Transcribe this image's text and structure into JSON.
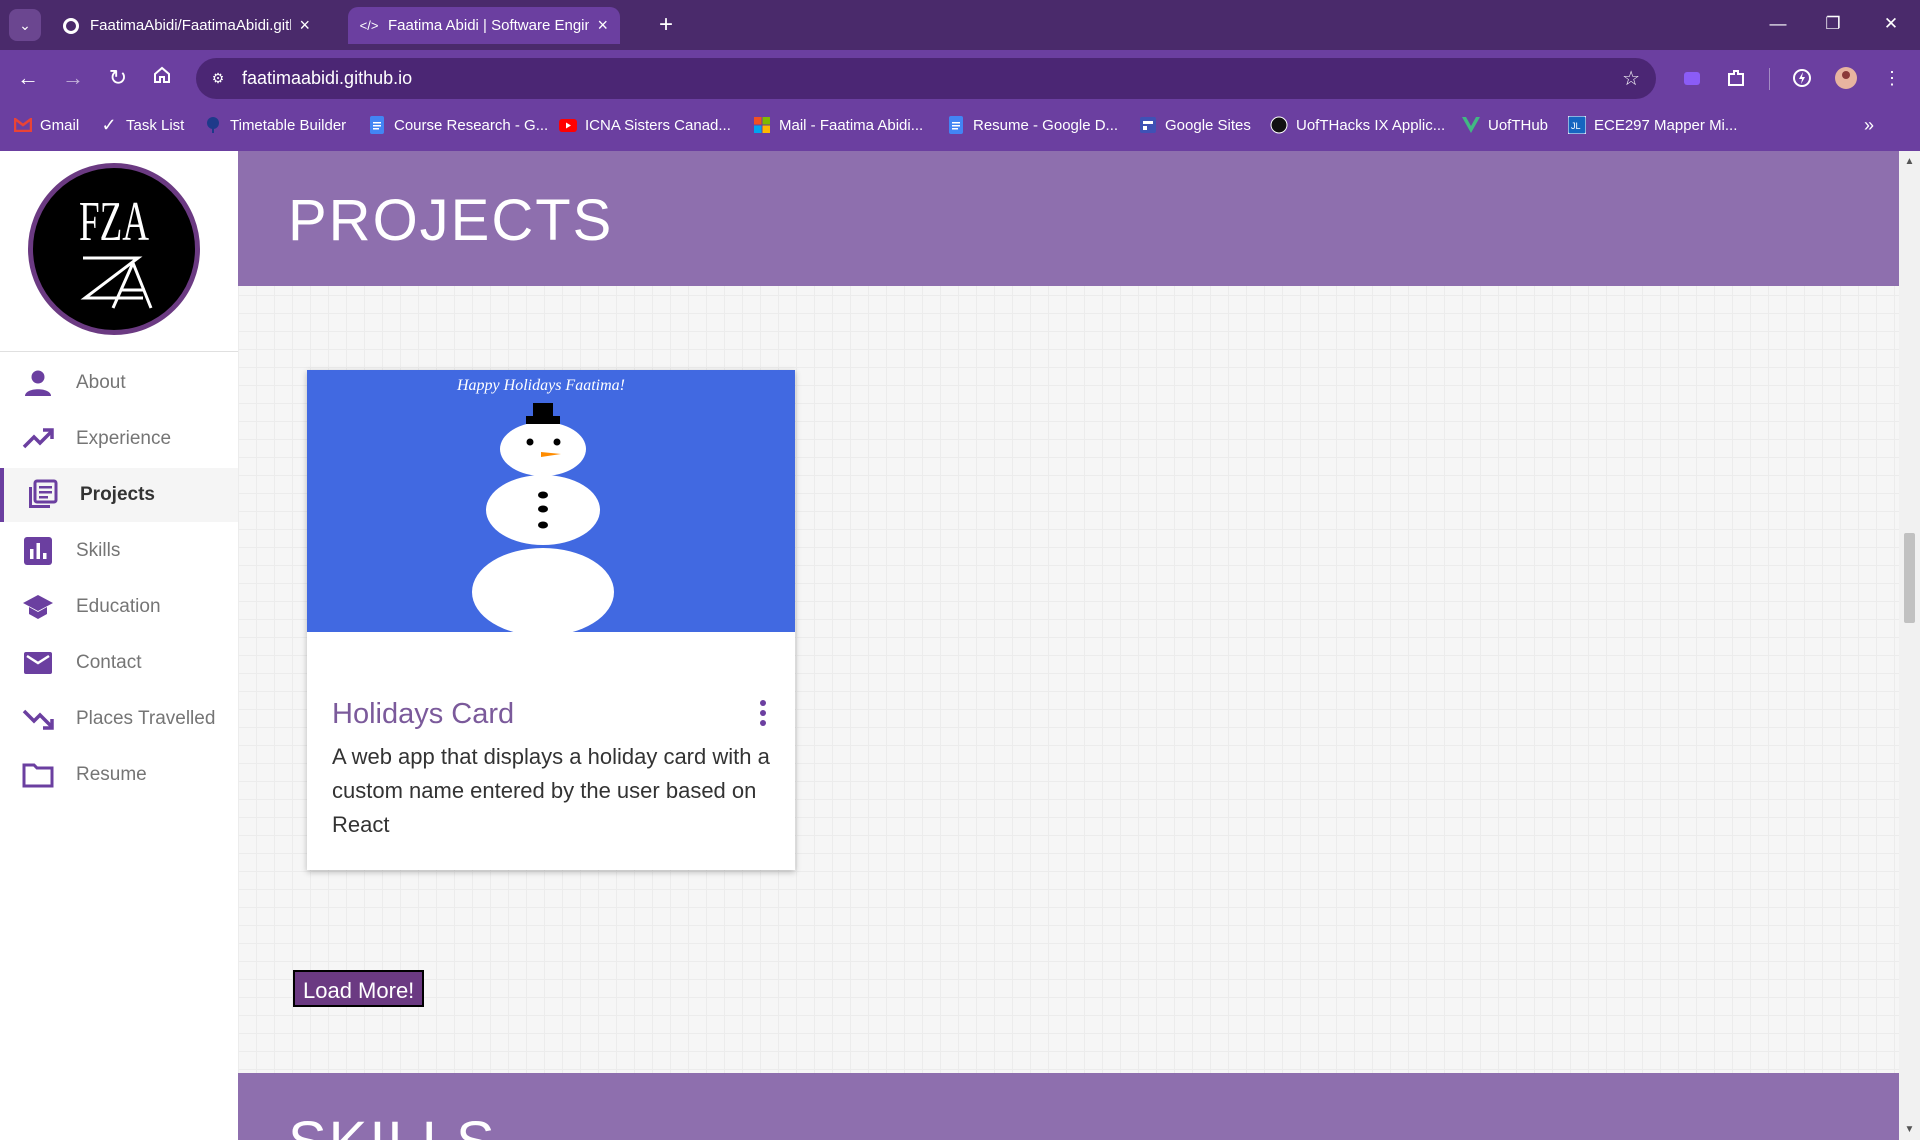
{
  "browser": {
    "tabs": [
      {
        "title": "FaatimaAbidi/FaatimaAbidi.github.io",
        "active": false,
        "icon": "github-icon"
      },
      {
        "title": "Faatima Abidi | Software Engineer",
        "active": true,
        "icon": "code-icon"
      }
    ],
    "url": "faatimaabidi.github.io",
    "bookmarks": [
      {
        "label": "Gmail",
        "icon": "gmail-icon",
        "color": "#ea4335"
      },
      {
        "label": "Task List",
        "icon": "check-icon",
        "color": "#ffffff"
      },
      {
        "label": "Timetable Builder",
        "icon": "tree-icon",
        "color": "#1e3a8a"
      },
      {
        "label": "Course Research - G...",
        "icon": "docs-icon",
        "color": "#4285f4"
      },
      {
        "label": "ICNA Sisters Canad...",
        "icon": "youtube-icon",
        "color": "#ff0000"
      },
      {
        "label": "Mail - Faatima Abidi...",
        "icon": "microsoft-icon",
        "color": "#f25022"
      },
      {
        "label": "Resume - Google D...",
        "icon": "docs-icon",
        "color": "#4285f4"
      },
      {
        "label": "Google Sites",
        "icon": "sites-icon",
        "color": "#3f51b5"
      },
      {
        "label": "UofTHacks IX Applic...",
        "icon": "circle-icon",
        "color": "#111111"
      },
      {
        "label": "UofTHub",
        "icon": "vue-icon",
        "color": "#41b883"
      },
      {
        "label": "ECE297 Mapper Mi...",
        "icon": "jl-icon",
        "color": "#1565c0"
      }
    ]
  },
  "logo": {
    "text": "FZA"
  },
  "sidebar": {
    "items": [
      {
        "label": "About",
        "icon": "person-icon",
        "active": false
      },
      {
        "label": "Experience",
        "icon": "trending-up-icon",
        "active": false
      },
      {
        "label": "Projects",
        "icon": "library-books-icon",
        "active": true
      },
      {
        "label": "Skills",
        "icon": "bar-chart-icon",
        "active": false
      },
      {
        "label": "Education",
        "icon": "school-icon",
        "active": false
      },
      {
        "label": "Contact",
        "icon": "mail-icon",
        "active": false
      },
      {
        "label": "Places Travelled",
        "icon": "trending-down-icon",
        "active": false
      },
      {
        "label": "Resume",
        "icon": "folder-icon",
        "active": false
      }
    ]
  },
  "projects": {
    "heading": "PROJECTS",
    "card": {
      "image_text": "Happy Holidays Faatima!",
      "title": "Holidays Card",
      "description": "A web app that displays a holiday card with a custom name entered by the user based on React"
    },
    "load_more": "Load More!"
  },
  "skills": {
    "heading": "SKILLS"
  },
  "colors": {
    "brand_purple": "#6b3fa0",
    "header_purple": "#8e6fae",
    "card_blue": "#4169e1"
  }
}
